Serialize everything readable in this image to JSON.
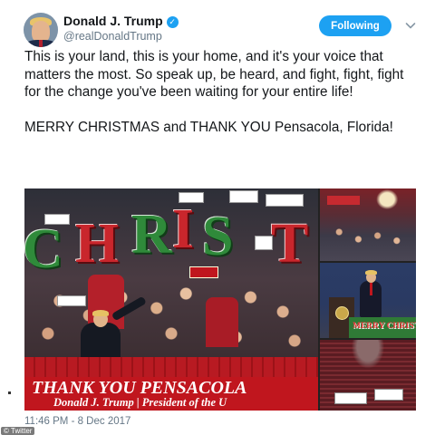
{
  "tweet": {
    "author_name": "Donald J. Trump",
    "handle": "@realDonaldTrump",
    "verified_glyph": "✓",
    "follow_label": "Following",
    "more_icon": "chevron-down-icon",
    "text_p1": "This is your land, this is your home, and it's your voice that matters the most. So speak up, be heard, and fight, fight, fight for the change you've been waiting for your entire life!",
    "text_p2": "MERRY CHRISTMAS and THANK YOU Pensacola, Florida!",
    "timestamp": "11:46 PM - 8 Dec 2017"
  },
  "media": {
    "main_photo": {
      "sign_letters": [
        "C",
        "H",
        "R",
        "I",
        "S",
        "T"
      ],
      "banner_line1": "THANK YOU PENSACOLA",
      "banner_line2": "Donald J. Trump | President of the U"
    },
    "side_photo_2": {
      "banner_text": "MERRY CHRISTMAS"
    }
  },
  "credit": {
    "copyright": "©",
    "source": "Twitter"
  },
  "colors": {
    "follow_button": "#1da1f2",
    "verified_badge": "#1da1f2",
    "handle_gray": "#657786",
    "banner_red": "#c0161e",
    "sign_green": "#2f8a3a"
  }
}
